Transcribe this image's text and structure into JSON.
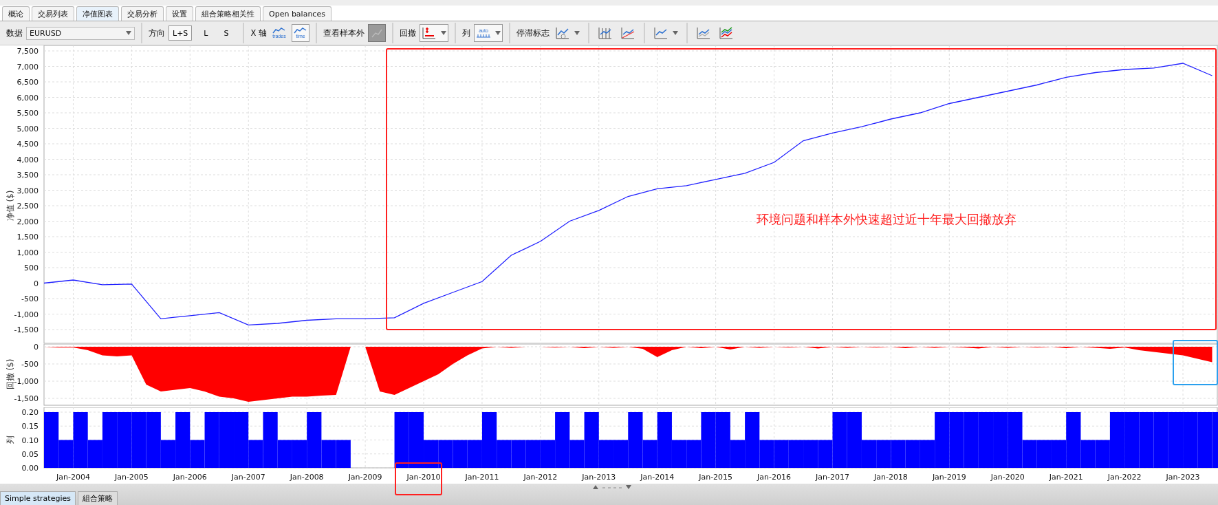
{
  "tabs": [
    {
      "label": "概论",
      "selected": false
    },
    {
      "label": "交易列表",
      "selected": false
    },
    {
      "label": "净值图表",
      "selected": true
    },
    {
      "label": "交易分析",
      "selected": false
    },
    {
      "label": "设置",
      "selected": false
    },
    {
      "label": "組合策略相关性",
      "selected": false
    },
    {
      "label": "Open balances",
      "selected": false
    }
  ],
  "toolbar": {
    "data_label": "数据",
    "symbol": "EURUSD",
    "direction_label": "方向",
    "directions": [
      {
        "label": "L+S",
        "selected": true
      },
      {
        "label": "L",
        "selected": false
      },
      {
        "label": "S",
        "selected": false
      }
    ],
    "xaxis_label": "X 轴",
    "xaxis_options": [
      {
        "label": "trades",
        "selected": false
      },
      {
        "label": "time",
        "selected": true
      }
    ],
    "oos_label": "查看样本外",
    "drawdown_label": "回撤",
    "column_label": "列",
    "column_icon_label": "auto",
    "stagnation_label": "停滞标志"
  },
  "equity": {
    "chart_data": {
      "type": "line",
      "ylabel": "净值 ($)",
      "grid": true,
      "ylim": [
        -1500,
        7500
      ],
      "yticks": [
        {
          "value": 7500,
          "label": "7,500"
        },
        {
          "value": 7000,
          "label": "7,000"
        },
        {
          "value": 6500,
          "label": "6,500"
        },
        {
          "value": 6000,
          "label": "6,000"
        },
        {
          "value": 5500,
          "label": "5,500"
        },
        {
          "value": 5000,
          "label": "5,000"
        },
        {
          "value": 4500,
          "label": "4,500"
        },
        {
          "value": 4000,
          "label": "4,000"
        },
        {
          "value": 3500,
          "label": "3,500"
        },
        {
          "value": 3000,
          "label": "3,000"
        },
        {
          "value": 2500,
          "label": "2,500"
        },
        {
          "value": 2000,
          "label": "2,000"
        },
        {
          "value": 1500,
          "label": "1,500"
        },
        {
          "value": 1000,
          "label": "1,000"
        },
        {
          "value": 500,
          "label": "500"
        },
        {
          "value": 0,
          "label": "0"
        },
        {
          "value": -500,
          "label": "-500"
        },
        {
          "value": -1000,
          "label": "-1,000"
        },
        {
          "value": -1500,
          "label": "-1,500"
        }
      ],
      "series": [
        {
          "color": "#2020ff",
          "values": [
            0,
            100,
            -50,
            -30,
            -1150,
            -1050,
            -950,
            -1350,
            -1300,
            -1200,
            -1150,
            -1150,
            -1120,
            -650,
            -300,
            50,
            900,
            1350,
            2000,
            2350,
            2800,
            3050,
            3150,
            3350,
            3550,
            3900,
            4600,
            4850,
            5050,
            5300,
            5500,
            5800,
            6000,
            6200,
            6400,
            6650,
            6800,
            6900,
            6950,
            7100,
            6700
          ]
        }
      ]
    }
  },
  "drawdown": {
    "chart_data": {
      "type": "area",
      "ylabel": "回撤 ($)",
      "grid": true,
      "ylim": [
        -1700,
        0
      ],
      "yticks": [
        {
          "value": 0,
          "label": "0"
        },
        {
          "value": -500,
          "label": "-500"
        },
        {
          "value": -1000,
          "label": "-1,000"
        },
        {
          "value": -1500,
          "label": "-1,500"
        }
      ],
      "series": [
        {
          "color": "#ff0000",
          "values": [
            0,
            -20,
            -20,
            -100,
            -250,
            -280,
            -250,
            -1100,
            -1300,
            -1250,
            -1200,
            -1300,
            -1450,
            -1500,
            -1600,
            -1550,
            -1500,
            -1450,
            -1450,
            -1420,
            -1400,
            0,
            0,
            -1300,
            -1400,
            -1200,
            -1000,
            -800,
            -500,
            -250,
            -50,
            0,
            -30,
            0,
            0,
            -20,
            0,
            -40,
            0,
            -30,
            0,
            -60,
            -300,
            -100,
            0,
            -40,
            0,
            -80,
            0,
            -30,
            0,
            -20,
            0,
            -50,
            0,
            -30,
            0,
            -20,
            0,
            -40,
            0,
            -30,
            0,
            -20,
            -50,
            0,
            -30,
            0,
            -20,
            0,
            -40,
            0,
            -30,
            -60,
            -20,
            -100,
            -150,
            -200,
            -250,
            -350,
            -450
          ]
        }
      ]
    }
  },
  "trades": {
    "chart_data": {
      "type": "bar",
      "ylabel": "列",
      "grid": true,
      "ylim": [
        0,
        0.2
      ],
      "yticks": [
        {
          "value": 0.2,
          "label": "0.20"
        },
        {
          "value": 0.15,
          "label": "0.15"
        },
        {
          "value": 0.1,
          "label": "0.10"
        },
        {
          "value": 0.05,
          "label": "0.05"
        },
        {
          "value": 0,
          "label": "0.00"
        }
      ],
      "categories": [
        null,
        null,
        "Jan-2004",
        null,
        null,
        null,
        "Jan-2005",
        null,
        null,
        null,
        "Jan-2006",
        null,
        null,
        null,
        "Jan-2007",
        null,
        null,
        null,
        "Jan-2008",
        null,
        null,
        null,
        "Jan-2009",
        null,
        null,
        null,
        "Jan-2010",
        null,
        null,
        null,
        "Jan-2011",
        null,
        null,
        null,
        "Jan-2012",
        null,
        null,
        null,
        "Jan-2013",
        null,
        null,
        null,
        "Jan-2014",
        null,
        null,
        null,
        "Jan-2015",
        null,
        null,
        null,
        "Jan-2016",
        null,
        null,
        null,
        "Jan-2017",
        null,
        null,
        null,
        "Jan-2018",
        null,
        null,
        null,
        "Jan-2019",
        null,
        null,
        null,
        "Jan-2020",
        null,
        null,
        null,
        "Jan-2021",
        null,
        null,
        null,
        "Jan-2022",
        null,
        null,
        null,
        "Jan-2023",
        null,
        null
      ],
      "series": [
        {
          "color": "#0000ff",
          "values": [
            0.2,
            0.1,
            0.2,
            0.1,
            0.2,
            0.2,
            0.2,
            0.2,
            0.1,
            0.2,
            0.1,
            0.2,
            0.2,
            0.2,
            0.1,
            0.2,
            0.1,
            0.1,
            0.2,
            0.1,
            0.1,
            0,
            0,
            0,
            0.2,
            0.2,
            0.1,
            0.1,
            0.1,
            0.1,
            0.2,
            0.1,
            0.1,
            0.1,
            0.1,
            0.2,
            0.1,
            0.2,
            0.1,
            0.1,
            0.2,
            0.1,
            0.2,
            0.1,
            0.1,
            0.2,
            0.2,
            0.1,
            0.2,
            0.1,
            0.1,
            0.1,
            0.1,
            0.1,
            0.2,
            0.2,
            0.1,
            0.1,
            0.1,
            0.1,
            0.1,
            0.2,
            0.2,
            0.2,
            0.2,
            0.2,
            0.2,
            0.1,
            0.1,
            0.1,
            0.2,
            0.1,
            0.1,
            0.2,
            0.2,
            0.2,
            0.2,
            0.2,
            0.2,
            0.2,
            0.2
          ]
        }
      ]
    }
  },
  "annotation": {
    "text": "环境问题和样本外快速超过近十年最大回撤放弃",
    "boxes": [
      {
        "kind": "main",
        "color": "#ff2020"
      },
      {
        "kind": "xlabel",
        "color": "#ff2020"
      },
      {
        "kind": "corner",
        "color": "#2aa0ee"
      }
    ]
  },
  "bottom_tabs": [
    {
      "label": "Simple strategies",
      "selected": true
    },
    {
      "label": "組合策略",
      "selected": false
    }
  ]
}
